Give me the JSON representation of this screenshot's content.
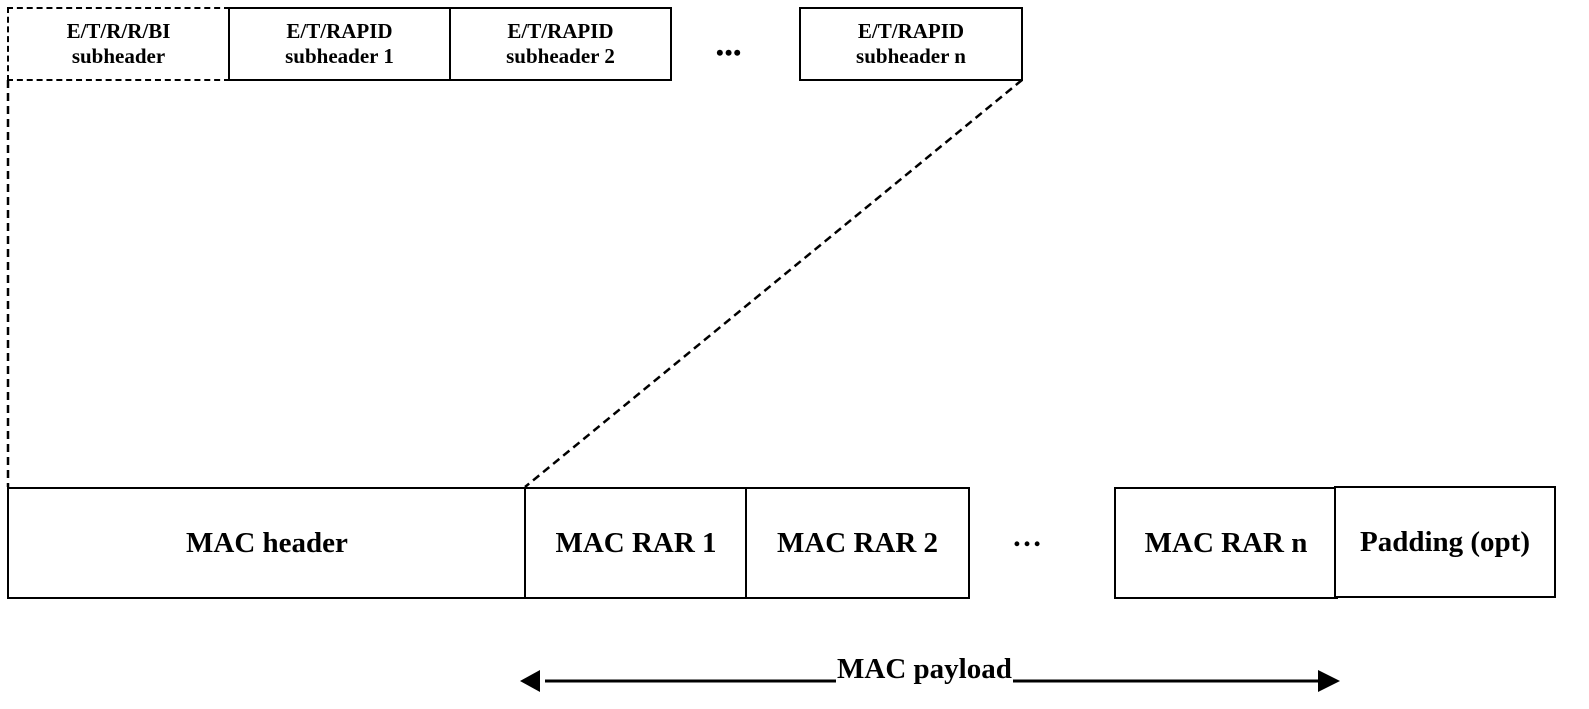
{
  "subheaders": [
    {
      "line1": "E/T/R/R/BI",
      "line2": "subheader",
      "style": "dashed"
    },
    {
      "line1": "E/T/RAPID",
      "line2": "subheader 1",
      "style": "solid"
    },
    {
      "line1": "E/T/RAPID",
      "line2": "subheader 2",
      "style": "solid"
    },
    {
      "line1": "E/T/RAPID",
      "line2": "subheader n",
      "style": "solid"
    }
  ],
  "top_ellipsis": "•••",
  "pdu": {
    "mac_header": "MAC header",
    "rars": [
      "MAC RAR 1",
      "MAC RAR 2",
      "MAC RAR n"
    ],
    "padding": "Padding (opt)",
    "ellipsis": "…"
  },
  "payload_label": "MAC payload",
  "colors": {
    "line": "#000000",
    "background": "#ffffff"
  }
}
